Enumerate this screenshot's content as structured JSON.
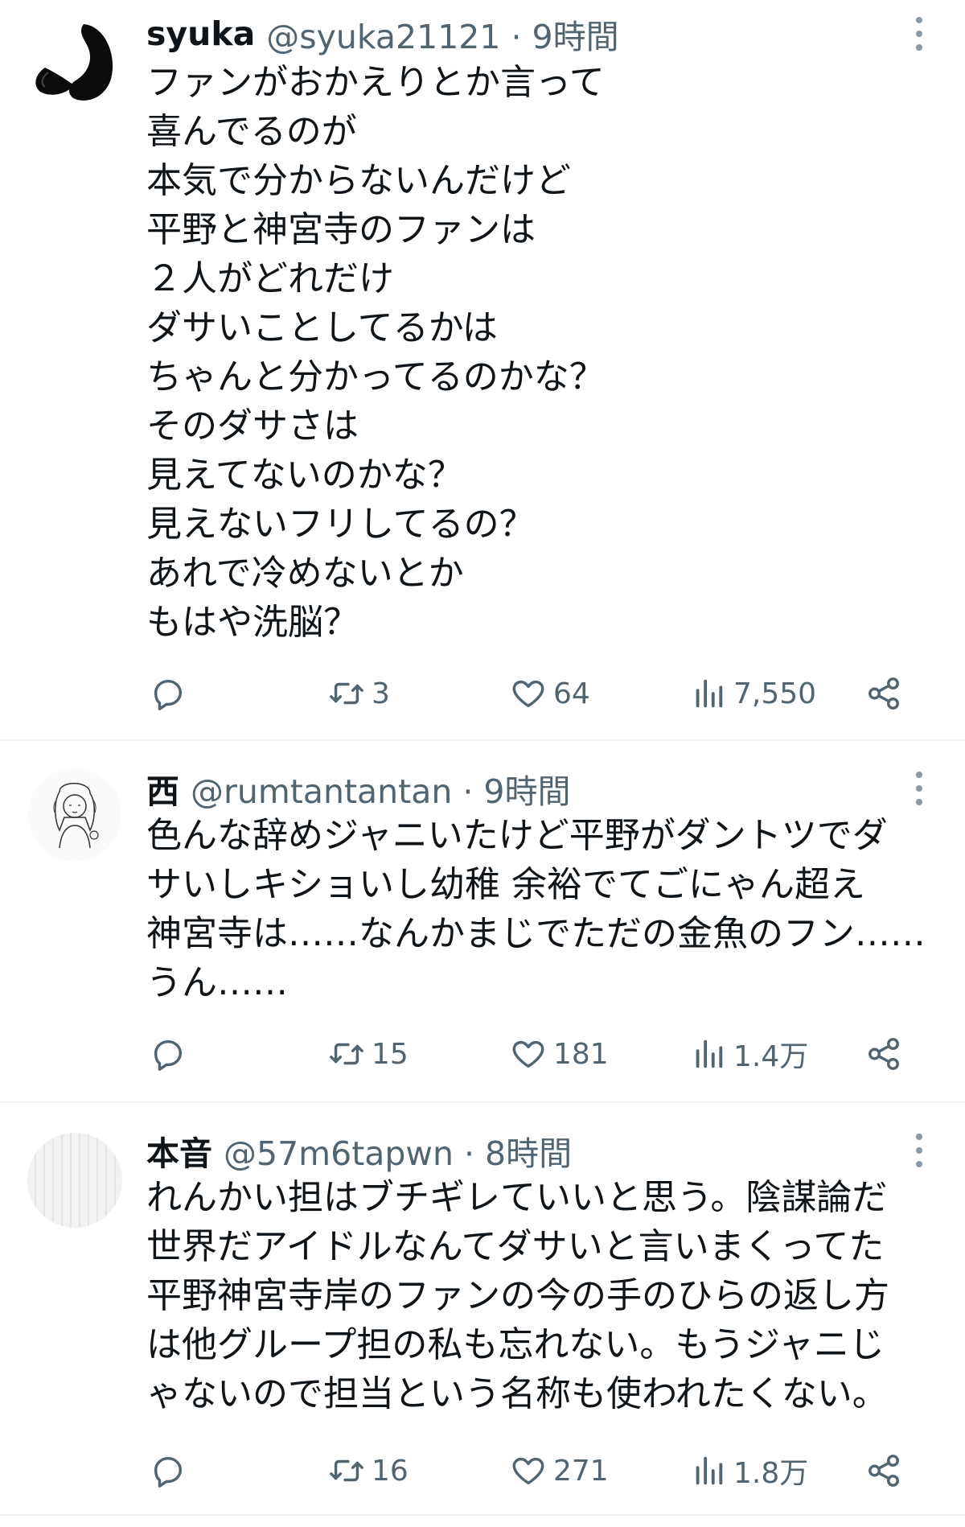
{
  "tweets": [
    {
      "name": "syuka",
      "meta": "@syuka21121 · 9時間",
      "lines": [
        "ファンがおかえりとか言って",
        "喜んでるのが",
        "本気で分からないんだけど",
        "平野と神宮寺のファンは",
        "２人がどれだけ",
        "ダサいことしてるかは",
        "ちゃんと分かってるのかな？",
        "そのダサさは",
        "見えてないのかな？",
        "見えないフリしてるの？",
        "あれで冷めないとか",
        "もはや洗脳？"
      ],
      "retweets": "3",
      "likes": "64",
      "views": "7,550"
    },
    {
      "name": "西",
      "meta": "@rumtantantan · 9時間",
      "lines": [
        "色んな辞めジャニいたけど平野がダントツでダ",
        "サいしキショいし幼稚 余裕でてごにゃん超え",
        "神宮寺は……なんかまじでただの金魚のフン……",
        "うん……"
      ],
      "retweets": "15",
      "likes": "181",
      "views": "1.4万"
    },
    {
      "name": "本音",
      "meta": "@57m6tapwn · 8時間",
      "lines": [
        "れんかい担はブチギレていいと思う。陰謀論だ",
        "世界だアイドルなんてダサいと言いまくってた",
        "平野神宮寺岸のファンの今の手のひらの返し方",
        "は他グループ担の私も忘れない。もうジャニじ",
        "ゃないので担当という名称も使われたくない。"
      ],
      "retweets": "16",
      "likes": "271",
      "views": "1.8万"
    }
  ],
  "icons": {
    "reply": "reply-icon",
    "retweet": "retweet-icon",
    "like": "heart-icon",
    "views": "views-icon",
    "share": "share-icon",
    "more": "more-icon"
  },
  "colors": {
    "text": "#0f1419",
    "secondary": "#536471",
    "divider": "#eff3f4"
  }
}
